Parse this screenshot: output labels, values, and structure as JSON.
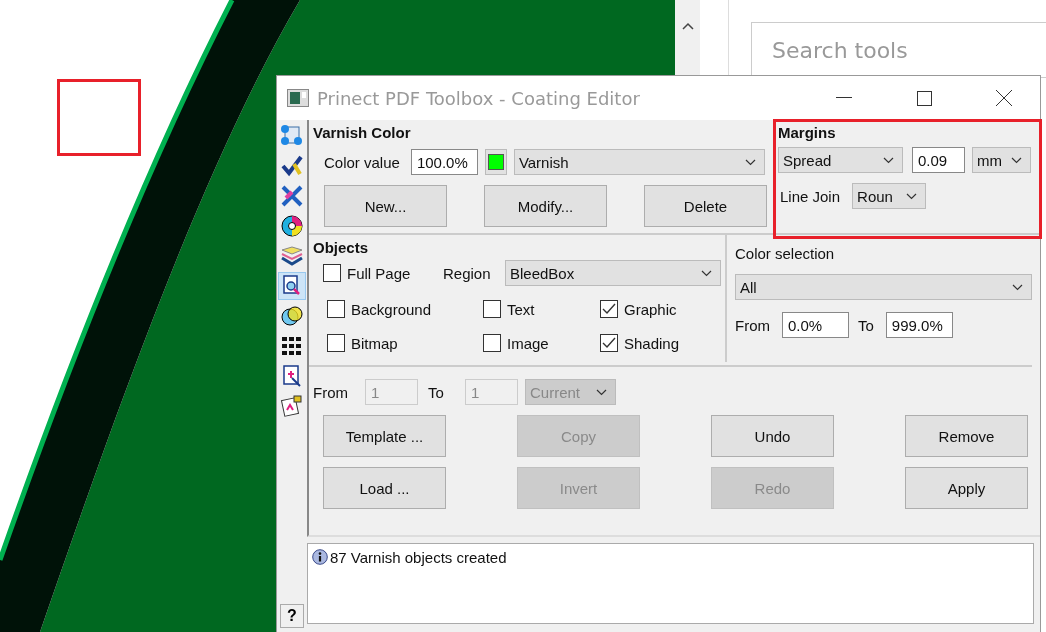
{
  "search": {
    "placeholder": "Search tools"
  },
  "window": {
    "title": "Prinect PDF Toolbox - Coating Editor"
  },
  "sidebar": {
    "tools": [
      {
        "selected": false
      },
      {
        "selected": false
      },
      {
        "selected": false
      },
      {
        "selected": false
      },
      {
        "selected": false
      },
      {
        "selected": true
      },
      {
        "selected": false
      },
      {
        "selected": false
      },
      {
        "selected": false
      },
      {
        "selected": false
      }
    ],
    "help": "?"
  },
  "varnish_color": {
    "title": "Varnish Color",
    "color_value_label": "Color value",
    "color_value": "100.0%",
    "color_name": "Varnish",
    "buttons": [
      "New...",
      "Modify...",
      "Delete"
    ]
  },
  "margins": {
    "title": "Margins",
    "mode": "Spread",
    "value": "0.09",
    "unit": "mm",
    "line_join_label": "Line Join",
    "line_join": "Roun"
  },
  "objects": {
    "title": "Objects",
    "full_page": {
      "label": "Full Page",
      "checked": false
    },
    "region_label": "Region",
    "region": "BleedBox",
    "types": [
      {
        "label": "Background",
        "checked": false
      },
      {
        "label": "Text",
        "checked": false
      },
      {
        "label": "Graphic",
        "checked": true
      },
      {
        "label": "Bitmap",
        "checked": false
      },
      {
        "label": "Image",
        "checked": false
      },
      {
        "label": "Shading",
        "checked": true
      }
    ]
  },
  "color_selection": {
    "title": "Color selection",
    "value": "All",
    "from_label": "From",
    "from": "0.0%",
    "to_label": "To",
    "to": "999.0%"
  },
  "pages": {
    "from_label": "From",
    "from": "1",
    "to_label": "To",
    "to": "1",
    "scope": "Current",
    "disabled": true
  },
  "actions": [
    {
      "label": "Template ...",
      "disabled": false
    },
    {
      "label": "Copy",
      "disabled": true
    },
    {
      "label": "Undo",
      "disabled": false
    },
    {
      "label": "Remove",
      "disabled": false
    },
    {
      "label": "Load ...",
      "disabled": false
    },
    {
      "label": "Invert",
      "disabled": true
    },
    {
      "label": "Redo",
      "disabled": true
    },
    {
      "label": "Apply",
      "disabled": false
    }
  ],
  "message": "87 Varnish objects created"
}
